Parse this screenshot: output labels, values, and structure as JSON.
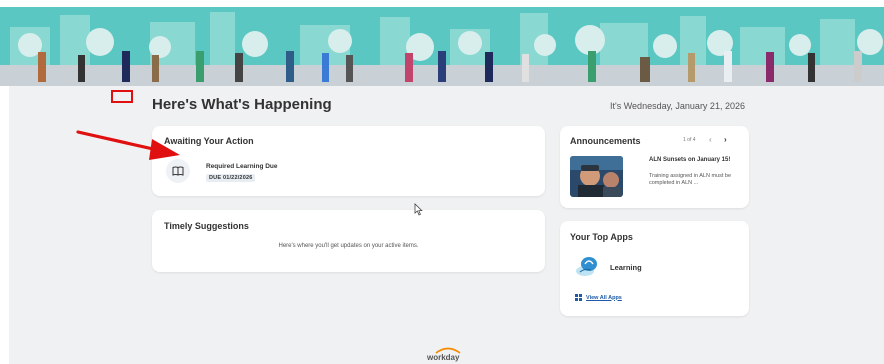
{
  "banner": {
    "sky": "#5bc7c3",
    "skyline": "#8ad8d2",
    "ground": "#c9d1d6"
  },
  "page": {
    "title": "Here's What's Happening",
    "date": "It's Wednesday, January 21, 2026"
  },
  "awaiting": {
    "heading": "Awaiting Your Action",
    "item_title": "Required Learning Due",
    "item_due": "DUE 01/22/2026",
    "icon": "book-icon"
  },
  "timely": {
    "heading": "Timely Suggestions",
    "message": "Here's where you'll get updates on your active items."
  },
  "announcements": {
    "heading": "Announcements",
    "pager": "1 of 4",
    "prev": "‹",
    "next": "›",
    "item_title": "ALN Sunsets on January 15!",
    "item_body": "Training assigned in ALN must be completed in ALN ..."
  },
  "apps": {
    "heading": "Your Top Apps",
    "app_label": "Learning",
    "view_all": "View All Apps"
  },
  "footer": {
    "brand": "workday"
  },
  "colors": {
    "annotation_red": "#e01010",
    "link_blue": "#1f5aa6",
    "accent_orange": "#f38b00"
  }
}
